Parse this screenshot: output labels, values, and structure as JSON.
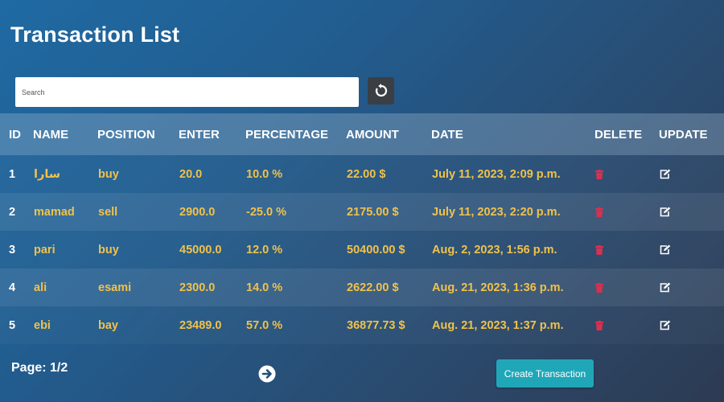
{
  "page": {
    "title": "Transaction List"
  },
  "search": {
    "placeholder": "Search",
    "value": ""
  },
  "table": {
    "headers": {
      "id": "ID",
      "name": "NAME",
      "position": "POSITION",
      "enter": "ENTER",
      "percentage": "PERCENTAGE",
      "amount": "AMOUNT",
      "date": "DATE",
      "delete": "DELETE",
      "update": "UPDATE"
    },
    "rows": [
      {
        "id": "1",
        "name": "سارا",
        "position": "buy",
        "enter": "20.0",
        "percentage": "10.0 %",
        "amount": "22.00 $",
        "date": "July 11, 2023, 2:09 p.m."
      },
      {
        "id": "2",
        "name": "mamad",
        "position": "sell",
        "enter": "2900.0",
        "percentage": "-25.0 %",
        "amount": "2175.00 $",
        "date": "July 11, 2023, 2:20 p.m."
      },
      {
        "id": "3",
        "name": "pari",
        "position": "buy",
        "enter": "45000.0",
        "percentage": "12.0 %",
        "amount": "50400.00 $",
        "date": "Aug. 2, 2023, 1:56 p.m."
      },
      {
        "id": "4",
        "name": "ali",
        "position": "esami",
        "enter": "2300.0",
        "percentage": "14.0 %",
        "amount": "2622.00 $",
        "date": "Aug. 21, 2023, 1:36 p.m."
      },
      {
        "id": "5",
        "name": "ebi",
        "position": "bay",
        "enter": "23489.0",
        "percentage": "57.0 %",
        "amount": "36877.73 $",
        "date": "Aug. 21, 2023, 1:37 p.m."
      }
    ]
  },
  "pagination": {
    "label": "Page: 1/2"
  },
  "actions": {
    "create_label": "Create Transaction"
  },
  "icons": {
    "refresh": "refresh-icon",
    "delete": "trash-icon",
    "update": "edit-icon",
    "next": "arrow-right-circle-icon"
  },
  "colors": {
    "accent_text": "#f0c24a",
    "delete_icon": "#d9304f",
    "create_button": "#1fa7b8"
  }
}
